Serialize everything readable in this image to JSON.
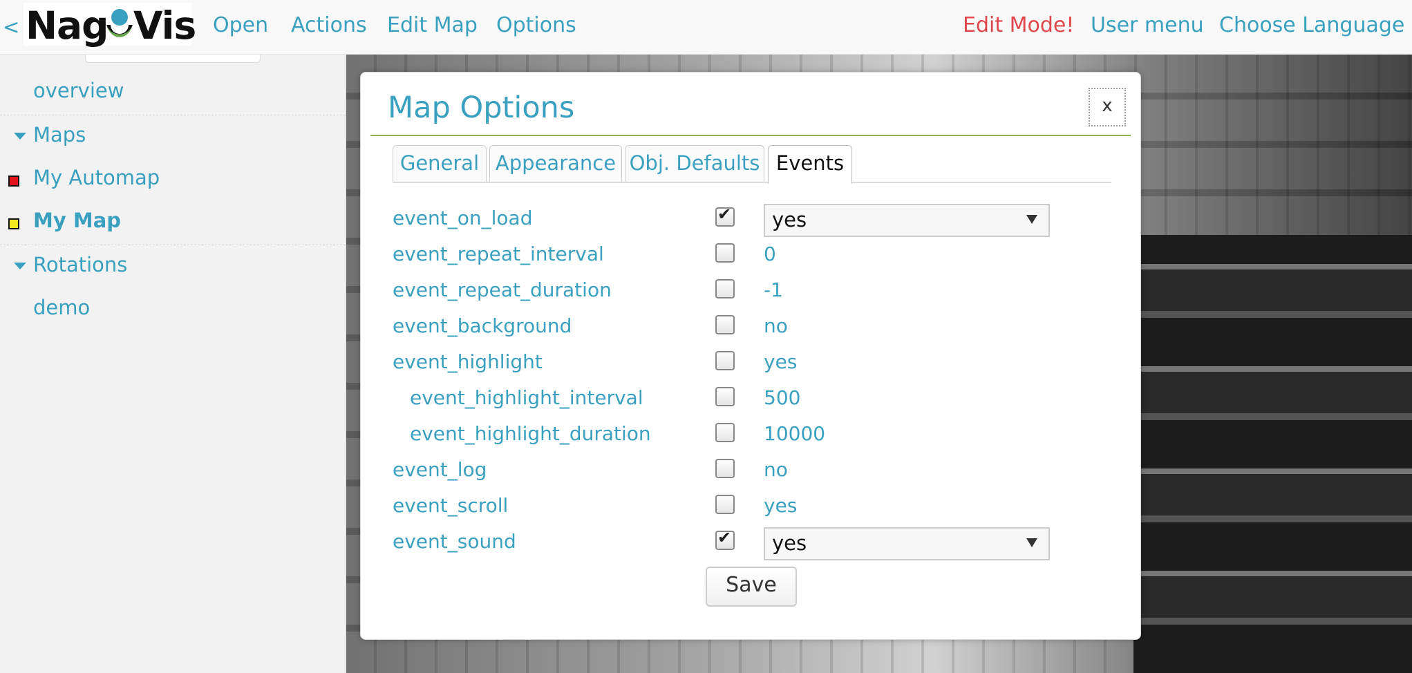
{
  "header": {
    "back_glyph": "<",
    "logo": {
      "part1": "Nag",
      "part2": "Vis"
    },
    "menu": [
      "Open",
      "Actions",
      "Edit Map",
      "Options"
    ],
    "right_menu": {
      "edit_mode": "Edit Mode!",
      "user_menu": "User menu",
      "language": "Choose Language"
    },
    "edit_mode_color": "#e0474c",
    "accent_color": "#3aa0c0"
  },
  "sidebar": {
    "overview": "overview",
    "maps_section": "Maps",
    "maps": [
      {
        "label": "My Automap",
        "status_color": "#e3131b"
      },
      {
        "label": "My Map",
        "status_color": "#f2ea1d",
        "active": true
      }
    ],
    "rotations_section": "Rotations",
    "rotations": [
      "demo"
    ]
  },
  "dialog": {
    "title": "Map Options",
    "close_label": "x",
    "tabs": [
      "General",
      "Appearance",
      "Obj. Defaults",
      "Events"
    ],
    "active_tab": "Events",
    "rows": [
      {
        "label": "event_on_load",
        "checked": true,
        "value": "yes",
        "control": "select"
      },
      {
        "label": "event_repeat_interval",
        "checked": false,
        "value": "0"
      },
      {
        "label": "event_repeat_duration",
        "checked": false,
        "value": "-1"
      },
      {
        "label": "event_background",
        "checked": false,
        "value": "no"
      },
      {
        "label": "event_highlight",
        "checked": false,
        "value": "yes"
      },
      {
        "label": "event_highlight_interval",
        "checked": false,
        "value": "500",
        "indent": true
      },
      {
        "label": "event_highlight_duration",
        "checked": false,
        "value": "10000",
        "indent": true
      },
      {
        "label": "event_log",
        "checked": false,
        "value": "no"
      },
      {
        "label": "event_scroll",
        "checked": false,
        "value": "yes"
      },
      {
        "label": "event_sound",
        "checked": true,
        "value": "yes",
        "control": "select"
      }
    ],
    "save_label": "Save"
  }
}
